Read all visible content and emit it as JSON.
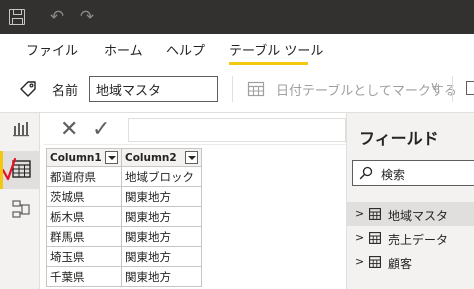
{
  "titlebar": {
    "save_icon": "save-icon",
    "undo_glyph": "↶",
    "redo_glyph": "↷"
  },
  "ribbon_tabs": [
    {
      "label": "ファイル"
    },
    {
      "label": "ホーム"
    },
    {
      "label": "ヘルプ"
    },
    {
      "label": "テーブル ツール",
      "active": true
    }
  ],
  "ribbon": {
    "name_label": "名前",
    "name_value": "地域マスタ",
    "mark_as_date_label": "日付テーブルとしてマークする",
    "mark_as_date_chevron": "∨"
  },
  "formula_bar": {
    "cancel_glyph": "✕",
    "commit_glyph": "✓"
  },
  "table": {
    "columns": [
      "Column1",
      "Column2"
    ],
    "rows": [
      [
        "都道府県",
        "地域ブロック"
      ],
      [
        "茨城県",
        "関東地方"
      ],
      [
        "栃木県",
        "関東地方"
      ],
      [
        "群馬県",
        "関東地方"
      ],
      [
        "埼玉県",
        "関東地方"
      ],
      [
        "千葉県",
        "関東地方"
      ]
    ]
  },
  "fields_pane": {
    "title": "フィールド",
    "search_placeholder": "検索",
    "items": [
      {
        "label": "地域マスタ",
        "selected": true
      },
      {
        "label": "売上データ",
        "selected": false
      },
      {
        "label": "顧客",
        "selected": false
      }
    ],
    "expand_glyph": ">"
  },
  "colors": {
    "accent": "#f2c811",
    "titlebar_bg": "#323130",
    "check_mark": "#e81123"
  }
}
